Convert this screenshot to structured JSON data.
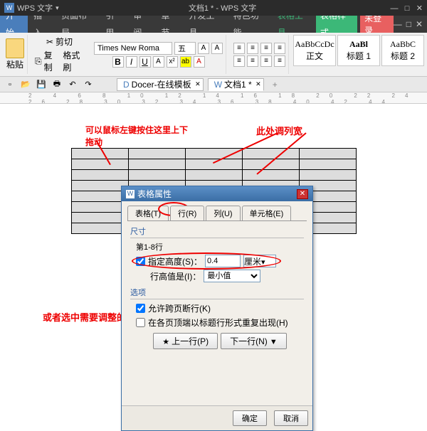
{
  "titlebar": {
    "app": "WPS 文字",
    "doc": "文档1 * - WPS 文字"
  },
  "menu": {
    "items": [
      "开始",
      "插入",
      "页面布局",
      "引用",
      "审阅",
      "章节",
      "开发工具",
      "特色功能"
    ],
    "table_tools": "表格工具",
    "table_style": "表格样式",
    "login": "未登录"
  },
  "ribbon": {
    "paste": "粘贴",
    "cut": "剪切",
    "copy": "复制",
    "fmtpaint": "格式刷",
    "font": "Times New Roma",
    "size": "五",
    "styles": [
      {
        "top": "AaBbCcDc",
        "bot": "正文"
      },
      {
        "top": "AaBl",
        "bot": "标题 1"
      },
      {
        "top": "AaBbC",
        "bot": "标题 2"
      }
    ]
  },
  "tabs": {
    "docer": "Docer-在线模板",
    "doc1": "文档1 *"
  },
  "ruler": "2 4 6 8 10 12 14 16 18 20 22 24 26 28 30 32 34 36 38 40 42 44",
  "annotations": {
    "a1a": "可以鼠标左键按住这里上下",
    "a1b": "拖动",
    "a2": "此处调列宽",
    "a3": "或者选中需要调整的表格，右键  表格属性里调整"
  },
  "dialog": {
    "title": "表格属性",
    "tabs": {
      "table": "表格(T)",
      "row": "行(R)",
      "col": "列(U)",
      "cell": "单元格(E)"
    },
    "size_hdr": "尺寸",
    "rows_label": "第1-8行",
    "spec_h": "指定高度(S)：",
    "h_val": "0.4",
    "h_unit": "厘米",
    "h_is": "行高值是(I)：",
    "h_is_val": "最小值",
    "opt_hdr": "选项",
    "opt1": "允许跨页断行(K)",
    "opt2": "在各页顶端以标题行形式重复出现(H)",
    "prev": "上一行(P)",
    "next": "下一行(N)",
    "ok": "确定",
    "cancel": "取消"
  }
}
